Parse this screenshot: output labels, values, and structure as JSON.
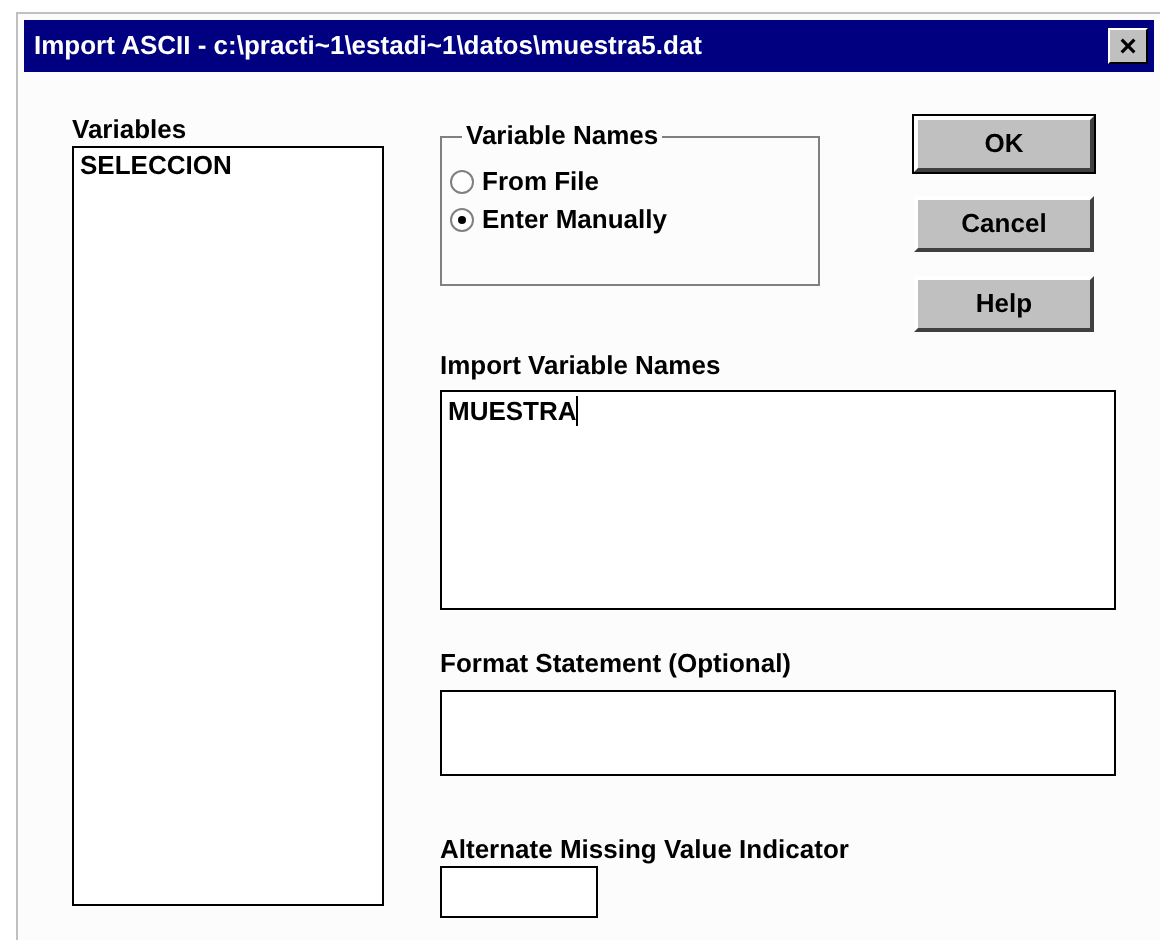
{
  "window": {
    "title": "Import ASCII - c:\\practi~1\\estadi~1\\datos\\muestra5.dat",
    "close": "×"
  },
  "variables": {
    "label": "Variables",
    "items": [
      {
        "text": "SELECCION",
        "selected": false
      }
    ]
  },
  "variable_names": {
    "label": "Variable Names",
    "options": [
      {
        "label": "From File",
        "selected": false
      },
      {
        "label": "Enter Manually",
        "selected": true
      }
    ]
  },
  "buttons": [
    "OK",
    "Cancel",
    "Help"
  ],
  "import_names": {
    "label": "Import Variable Names",
    "value": "MUESTRA"
  },
  "format_statement": {
    "label": "Format Statement (Optional)"
  },
  "missing_indicator": {
    "label": "Alternate Missing Value Indicator"
  }
}
